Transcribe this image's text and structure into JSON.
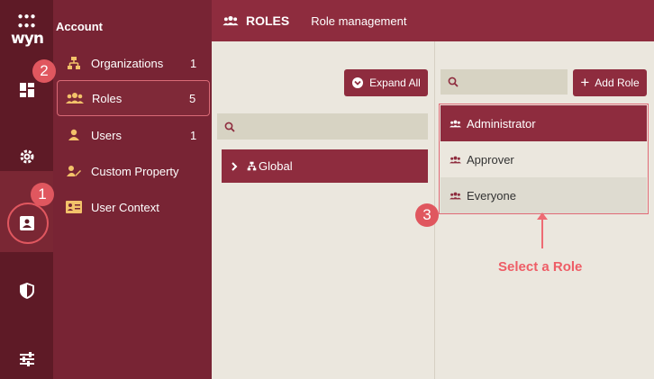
{
  "app": {
    "logo_text": "wyn"
  },
  "account_panel": {
    "title": "Account",
    "items": [
      {
        "label": "Organizations",
        "count": "1",
        "icon": "organization-icon"
      },
      {
        "label": "Roles",
        "count": "5",
        "icon": "roles-icon"
      },
      {
        "label": "Users",
        "count": "1",
        "icon": "user-icon"
      },
      {
        "label": "Custom Property",
        "count": "",
        "icon": "custom-property-icon"
      },
      {
        "label": "User Context",
        "count": "",
        "icon": "user-context-icon"
      }
    ]
  },
  "header": {
    "title": "ROLES",
    "subtitle": "Role management"
  },
  "middle": {
    "expand_all_label": "Expand All",
    "search_placeholder": "",
    "tree_root": "Global"
  },
  "roles": {
    "add_label": "Add Role",
    "search_placeholder": "",
    "items": [
      "Administrator",
      "Approver",
      "Everyone"
    ]
  },
  "annotations": {
    "badge1": "1",
    "badge2": "2",
    "badge3": "3",
    "callout": "Select a Role"
  },
  "colors": {
    "primary": "#8e2c3e",
    "rail": "#5e1a26",
    "panel": "#782434",
    "accent": "#e0575f",
    "background": "#ebe7de"
  }
}
